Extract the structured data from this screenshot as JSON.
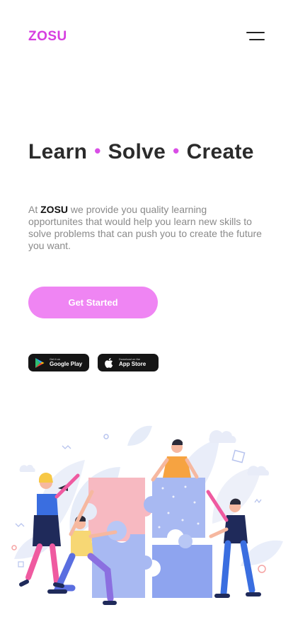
{
  "header": {
    "logo": "ZOSU",
    "menu_icon": "hamburger-menu-icon"
  },
  "hero": {
    "words": [
      "Learn",
      "Solve",
      "Create"
    ],
    "separator": "•",
    "desc_prefix": "At ",
    "desc_brand": "ZOSU",
    "desc_rest": " we provide you quality learning opportunites that would help you learn new skills to solve problems that can push you to create the future you want.",
    "cta_label": "Get Started"
  },
  "stores": {
    "google_small": "Get it on",
    "google_big": "Google Play",
    "apple_small": "Download on the",
    "apple_big": "App Store"
  },
  "colors": {
    "brand": "#d63ee0",
    "cta": "#ef85f3",
    "heading": "#2b2b2b",
    "body_text": "#8a8a8a"
  },
  "illustration": {
    "icon": "people-assembling-puzzle-illustration"
  }
}
